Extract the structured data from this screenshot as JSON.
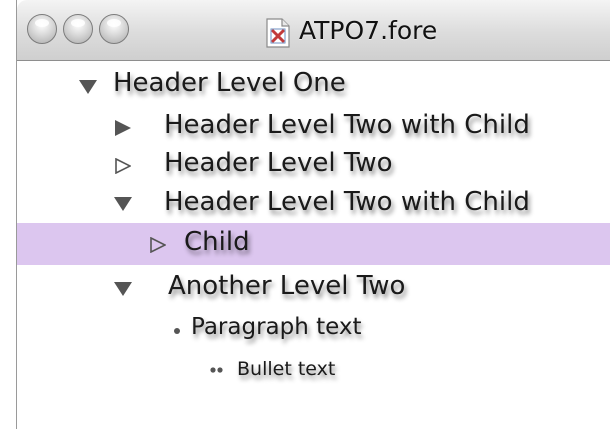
{
  "window": {
    "title": "ATPO7.fore",
    "file_icon": "document-icon"
  },
  "outline": [
    {
      "label": "Header Level One",
      "level": 1,
      "toggle": "expanded"
    },
    {
      "label": "Header Level Two with Child",
      "level": 2,
      "toggle": "collapsed-filled"
    },
    {
      "label": "Header Level Two",
      "level": 2,
      "toggle": "collapsed-hollow"
    },
    {
      "label": "Header Level Two with Child",
      "level": 2,
      "toggle": "expanded"
    },
    {
      "label": "Child",
      "level": 3,
      "toggle": "collapsed-hollow",
      "selected": true
    },
    {
      "label": "Another Level Two",
      "level": 2,
      "toggle": "expanded"
    },
    {
      "label": "Paragraph text",
      "level": 3,
      "toggle": "bullet"
    },
    {
      "label": "Bullet text",
      "level": 4,
      "toggle": "double-bullet"
    }
  ],
  "colors": {
    "selection": "#dcc6ef",
    "text": "#1a1a1a",
    "triangle": "#555555"
  }
}
